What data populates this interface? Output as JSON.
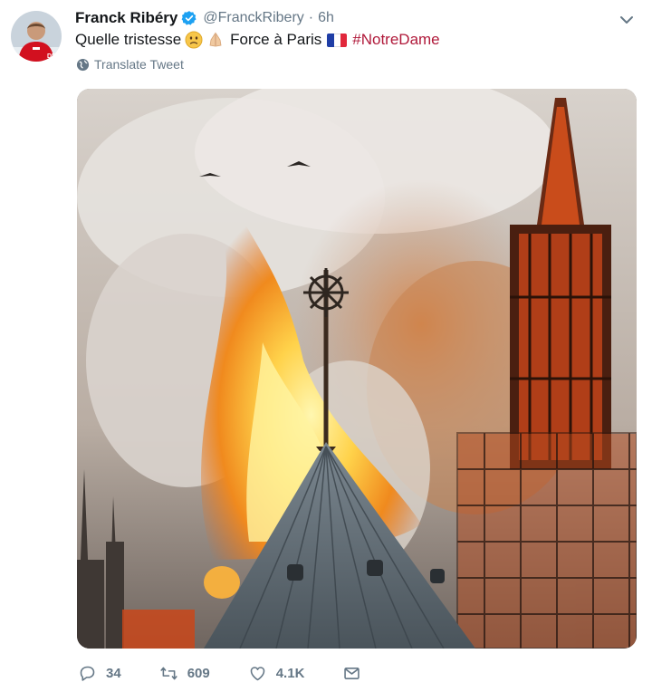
{
  "tweet": {
    "author_name": "Franck Ribéry",
    "handle": "@FranckRibery",
    "separator": "·",
    "time": "6h",
    "text_main": "Quelle tristesse",
    "text_force": "Force à Paris",
    "hashtag": "#NotreDame",
    "translate_label": "Translate Tweet",
    "icons": {
      "verified": "verified-badge-icon",
      "menu": "chevron-down-icon",
      "translate": "globe-icon",
      "reply": "reply-icon",
      "retweet": "retweet-icon",
      "like": "heart-icon",
      "dm": "envelope-icon"
    },
    "stats": {
      "replies": "34",
      "retweets": "609",
      "likes": "4.1K"
    },
    "colors": {
      "accent": "#1da1f2",
      "hashtag": "#b0193a",
      "secondary_text": "#657786"
    }
  }
}
